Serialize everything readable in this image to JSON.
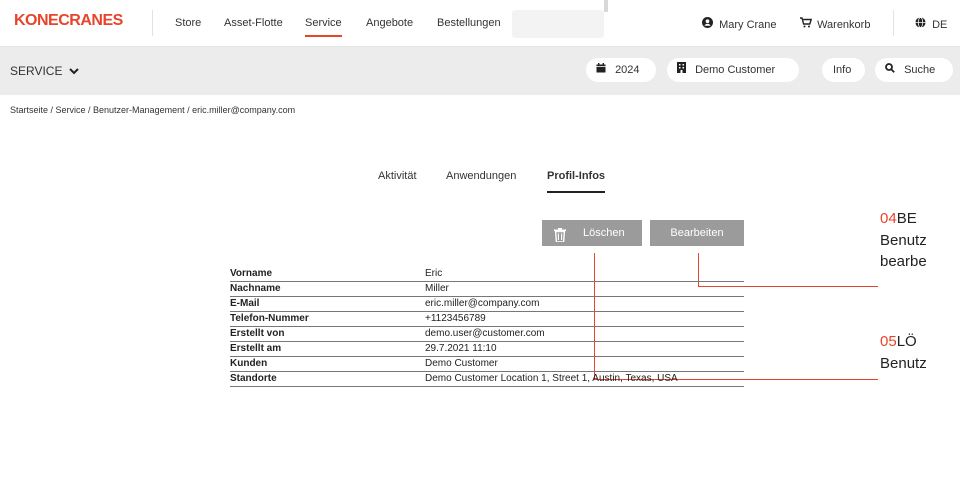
{
  "header": {
    "logo": "KONECRANES",
    "nav": [
      "Store",
      "Asset-Flotte",
      "Service",
      "Angebote",
      "Bestellungen"
    ],
    "user": "Mary Crane",
    "cart": "Warenkorb",
    "language": "DE"
  },
  "section_bar": {
    "title": "SERVICE",
    "year": "2024",
    "customer": "Demo Customer",
    "info": "Info",
    "search": "Suche"
  },
  "breadcrumb": "Startseite  /  Service  /  Benutzer-Management  /  eric.miller@company.com",
  "tabs": [
    "Aktivität",
    "Anwendungen",
    "Profil-Infos"
  ],
  "buttons": {
    "delete": "Löschen",
    "edit": "Bearbeiten"
  },
  "profile": [
    {
      "label": "Vorname",
      "value": "Eric"
    },
    {
      "label": "Nachname",
      "value": "Miller"
    },
    {
      "label": "E-Mail",
      "value": "eric.miller@company.com"
    },
    {
      "label": "Telefon-Nummer",
      "value": "+1123456789"
    },
    {
      "label": "Erstellt von",
      "value": "demo.user@customer.com"
    },
    {
      "label": "Erstellt am",
      "value": "29.7.2021 11:10"
    },
    {
      "label": "Kunden",
      "value": "Demo Customer"
    },
    {
      "label": "Standorte",
      "value": "Demo Customer Location 1, Street 1, Austin, Texas, USA"
    }
  ],
  "callouts": [
    {
      "num": "04",
      "title": "BE",
      "desc1": "Benutz",
      "desc2": "bearbe"
    },
    {
      "num": "05",
      "title": "LÖ",
      "desc1": "Benutz"
    }
  ],
  "colors": {
    "accent": "#e8442b",
    "button": "#9b9b9b"
  }
}
